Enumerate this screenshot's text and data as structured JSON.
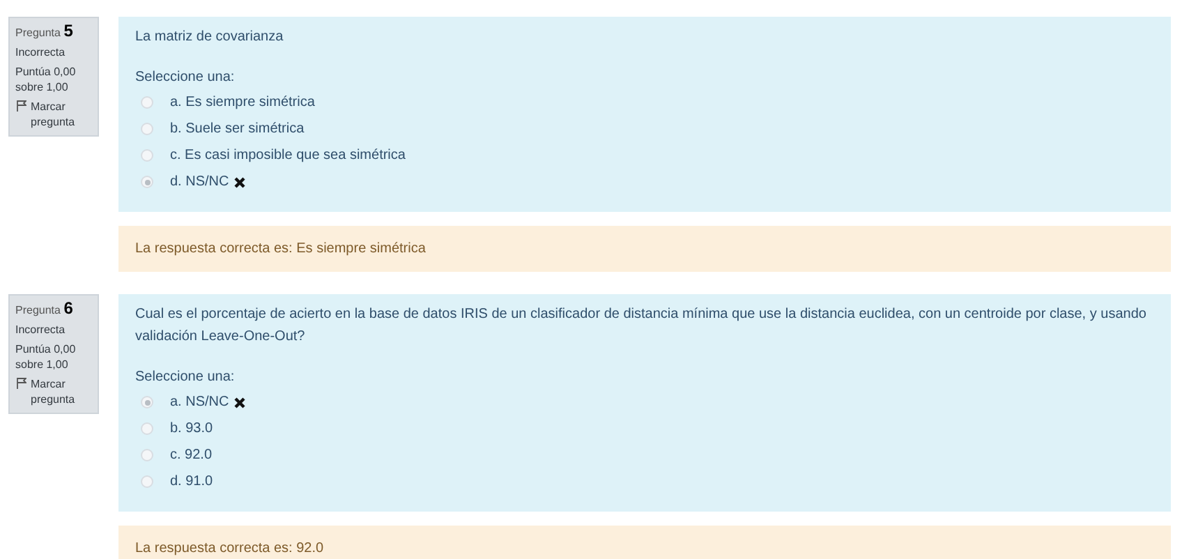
{
  "questions": [
    {
      "label": "Pregunta",
      "number": "5",
      "status": "Incorrecta",
      "score": "Puntúa 0,00 sobre 1,00",
      "flag": "Marcar pregunta",
      "text": "La matriz de covarianza",
      "prompt": "Seleccione una:",
      "options": [
        {
          "label": "a. Es siempre simétrica",
          "selected": false,
          "wrong": false
        },
        {
          "label": "b. Suele ser simétrica",
          "selected": false,
          "wrong": false
        },
        {
          "label": "c. Es casi imposible que sea simétrica",
          "selected": false,
          "wrong": false
        },
        {
          "label": "d. NS/NC",
          "selected": true,
          "wrong": true
        }
      ],
      "feedback": "La respuesta correcta es: Es siempre simétrica"
    },
    {
      "label": "Pregunta",
      "number": "6",
      "status": "Incorrecta",
      "score": "Puntúa 0,00 sobre 1,00",
      "flag": "Marcar pregunta",
      "text": "Cual es el porcentaje de acierto en la base de datos IRIS de un clasificador de distancia mínima que use la distancia euclidea, con un centroide por clase, y usando validación Leave-One-Out?",
      "prompt": "Seleccione una:",
      "options": [
        {
          "label": "a. NS/NC",
          "selected": true,
          "wrong": true
        },
        {
          "label": "b. 93.0",
          "selected": false,
          "wrong": false
        },
        {
          "label": "c. 92.0",
          "selected": false,
          "wrong": false
        },
        {
          "label": "d. 91.0",
          "selected": false,
          "wrong": false
        }
      ],
      "feedback": "La respuesta correcta es: 92.0"
    }
  ]
}
